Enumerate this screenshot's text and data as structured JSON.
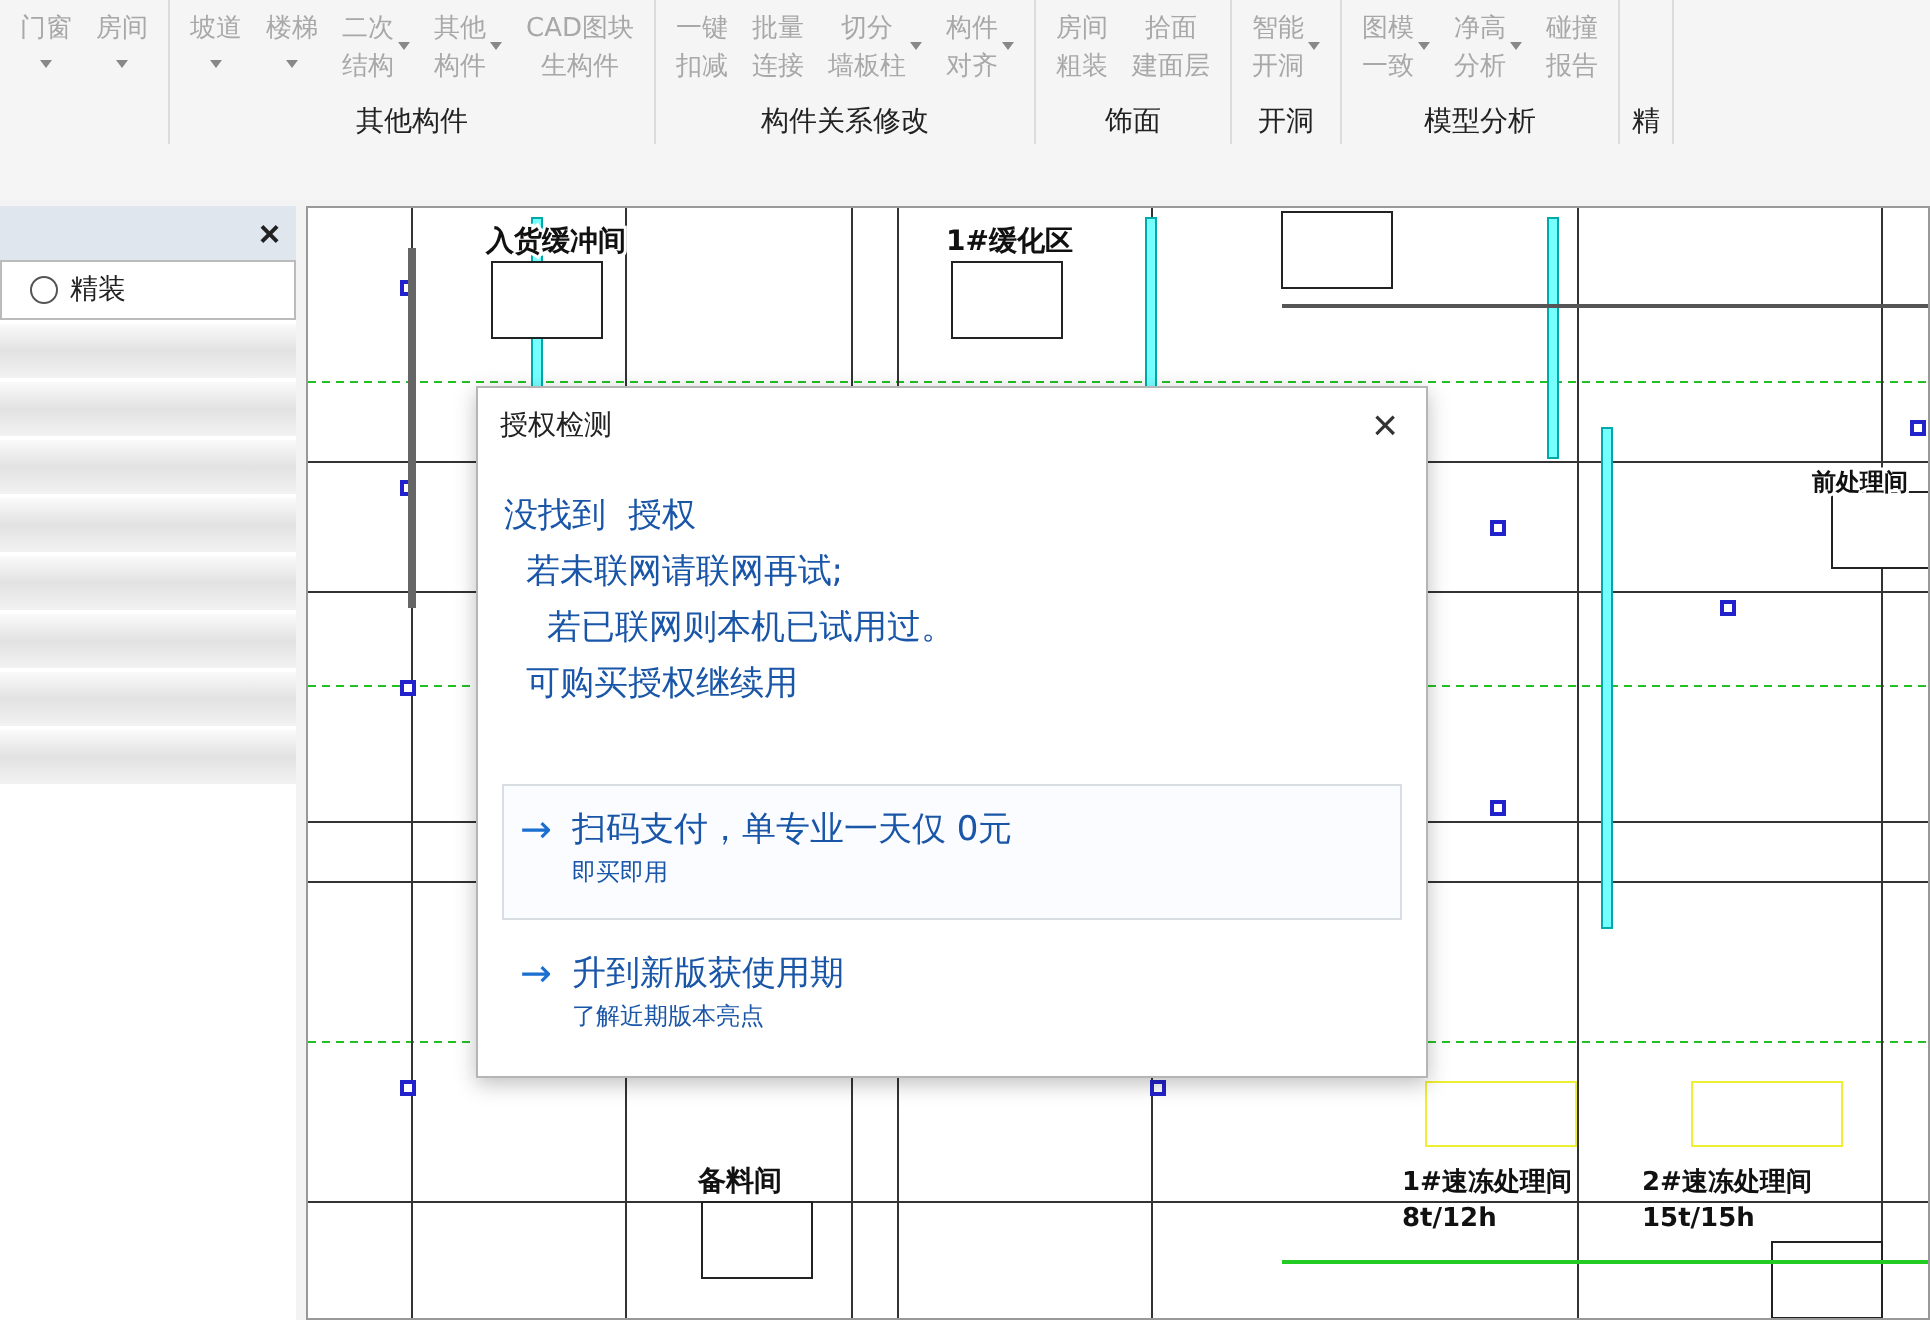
{
  "ribbon": {
    "groups": [
      {
        "buttons": [
          {
            "lines": [
              "门窗"
            ],
            "dropdown": true,
            "disabled": true
          },
          {
            "lines": [
              "房间"
            ],
            "dropdown": true,
            "disabled": true
          }
        ]
      },
      {
        "label": "其他构件",
        "buttons": [
          {
            "lines": [
              "坡道"
            ],
            "dropdown": true,
            "disabled": true
          },
          {
            "lines": [
              "楼梯"
            ],
            "dropdown": true,
            "disabled": true
          },
          {
            "lines": [
              "二次",
              "结构"
            ],
            "dropdown": true,
            "disabled": true
          },
          {
            "lines": [
              "其他",
              "构件"
            ],
            "dropdown": true,
            "disabled": true
          },
          {
            "lines": [
              "CAD图块",
              "生构件"
            ],
            "dropdown": false,
            "disabled": true
          }
        ]
      },
      {
        "label": "构件关系修改",
        "buttons": [
          {
            "lines": [
              "一键",
              "扣减"
            ],
            "dropdown": false,
            "disabled": true
          },
          {
            "lines": [
              "批量",
              "连接"
            ],
            "dropdown": false,
            "disabled": true
          },
          {
            "lines": [
              "切分",
              "墙板柱"
            ],
            "dropdown": true,
            "disabled": true
          },
          {
            "lines": [
              "构件",
              "对齐"
            ],
            "dropdown": true,
            "disabled": true
          }
        ]
      },
      {
        "label": "饰面",
        "buttons": [
          {
            "lines": [
              "房间",
              "粗装"
            ],
            "dropdown": false,
            "disabled": true
          },
          {
            "lines": [
              "拾面",
              "建面层"
            ],
            "dropdown": false,
            "disabled": true
          }
        ]
      },
      {
        "label": "开洞",
        "buttons": [
          {
            "lines": [
              "智能",
              "开洞"
            ],
            "dropdown": true,
            "disabled": true
          }
        ]
      },
      {
        "label": "模型分析",
        "buttons": [
          {
            "lines": [
              "图模",
              "一致"
            ],
            "dropdown": true,
            "disabled": true
          },
          {
            "lines": [
              "净高",
              "分析"
            ],
            "dropdown": true,
            "disabled": true
          },
          {
            "lines": [
              "碰撞",
              "报告"
            ],
            "dropdown": false,
            "disabled": true
          }
        ]
      },
      {
        "label": "精"
      }
    ]
  },
  "side_panel": {
    "close": "×",
    "radio": {
      "label": "精装",
      "selected": false
    }
  },
  "drawing": {
    "labels": [
      "入货缓冲间",
      "1#缓化区",
      "前处理间",
      "备料间",
      "1#速冻处理间",
      "8t/12h",
      "2#速冻处理间",
      "15t/15h"
    ]
  },
  "dialog": {
    "title": "授权检测",
    "close": "×",
    "message": [
      "没找到  授权",
      "  若未联网请联网再试;",
      "    若已联网则本机已试用过。",
      "  可购买授权继续用"
    ],
    "options": [
      {
        "arrow": "→",
        "title": "扫码支付，单专业一天仅 0元",
        "subtitle": "即买即用",
        "selected": true
      },
      {
        "arrow": "→",
        "title": "升到新版获使用期",
        "subtitle": "了解近期版本亮点",
        "selected": false
      }
    ]
  }
}
